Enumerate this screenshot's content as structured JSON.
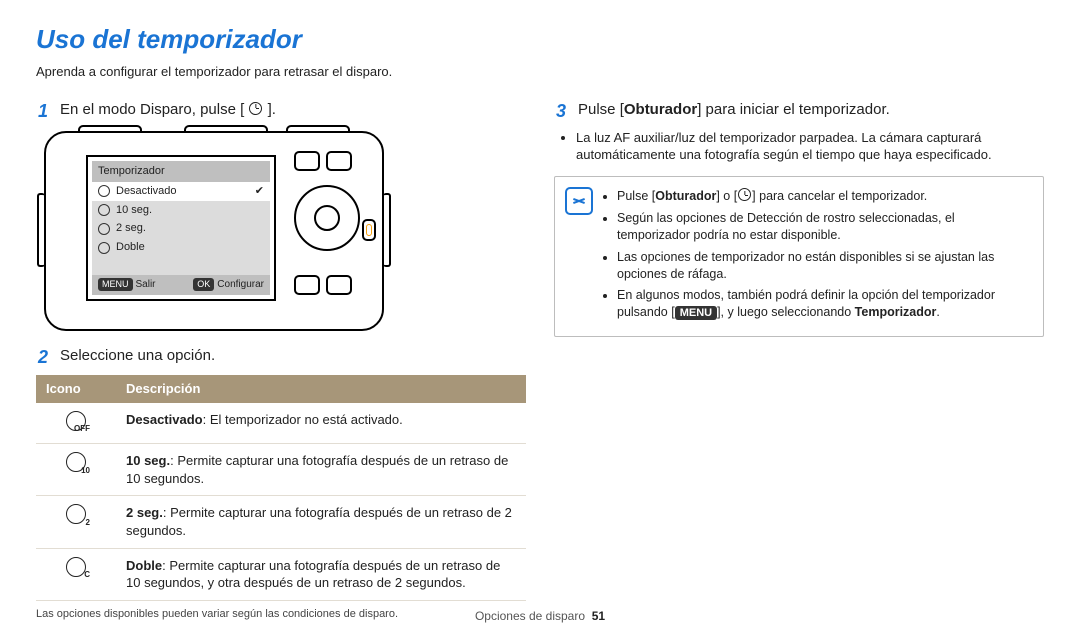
{
  "title": "Uso del temporizador",
  "intro": "Aprenda a configurar el temporizador para retrasar el disparo.",
  "steps": {
    "s1": {
      "num": "1",
      "text_pre": "En el modo Disparo, pulse [",
      "text_post": "]."
    },
    "s2": {
      "num": "2",
      "text": "Seleccione una opción."
    },
    "s3": {
      "num": "3",
      "text_pre": "Pulse [",
      "bold": "Obturador",
      "text_post": "] para iniciar el temporizador."
    }
  },
  "camera_screen": {
    "title": "Temporizador",
    "rows": [
      {
        "label": "Desactivado",
        "selected": true
      },
      {
        "label": "10 seg."
      },
      {
        "label": "2 seg."
      },
      {
        "label": "Doble"
      }
    ],
    "foot_left_pill": "MENU",
    "foot_left": "Salir",
    "foot_right_pill": "OK",
    "foot_right": "Configurar"
  },
  "table": {
    "hdr_icon": "Icono",
    "hdr_desc": "Descripción",
    "rows": [
      {
        "sub": "OFF",
        "bold": "Desactivado",
        "rest": ": El temporizador no está activado."
      },
      {
        "sub": "10",
        "bold": "10 seg.",
        "rest": ": Permite capturar una fotografía después de un retraso de 10 segundos."
      },
      {
        "sub": "2",
        "bold": "2 seg.",
        "rest": ": Permite capturar una fotografía después de un retraso de 2 segundos."
      },
      {
        "sub": "C",
        "bold": "Doble",
        "rest": ": Permite capturar una fotografía después de un retraso de 10 segundos, y otra después de un retraso de 2 segundos."
      }
    ],
    "footnote": "Las opciones disponibles pueden variar según las condiciones de disparo."
  },
  "step3_bullet": "La luz AF auxiliar/luz del temporizador parpadea. La cámara capturará automáticamente una fotografía según el tiempo que haya especificado.",
  "notebox": {
    "n1_pre": "Pulse [",
    "n1_b": "Obturador",
    "n1_mid": "] o [",
    "n1_post": "] para cancelar el temporizador.",
    "n2": "Según las opciones de Detección de rostro seleccionadas, el temporizador podría no estar disponible.",
    "n3": "Las opciones de temporizador no están disponibles si se ajustan las opciones de ráfaga.",
    "n4_pre": "En algunos modos, también podrá definir la opción del temporizador pulsando [",
    "n4_pill": "MENU",
    "n4_mid": "], y luego seleccionando ",
    "n4_b": "Temporizador",
    "n4_post": "."
  },
  "pagefoot": {
    "section": "Opciones de disparo",
    "num": "51"
  }
}
